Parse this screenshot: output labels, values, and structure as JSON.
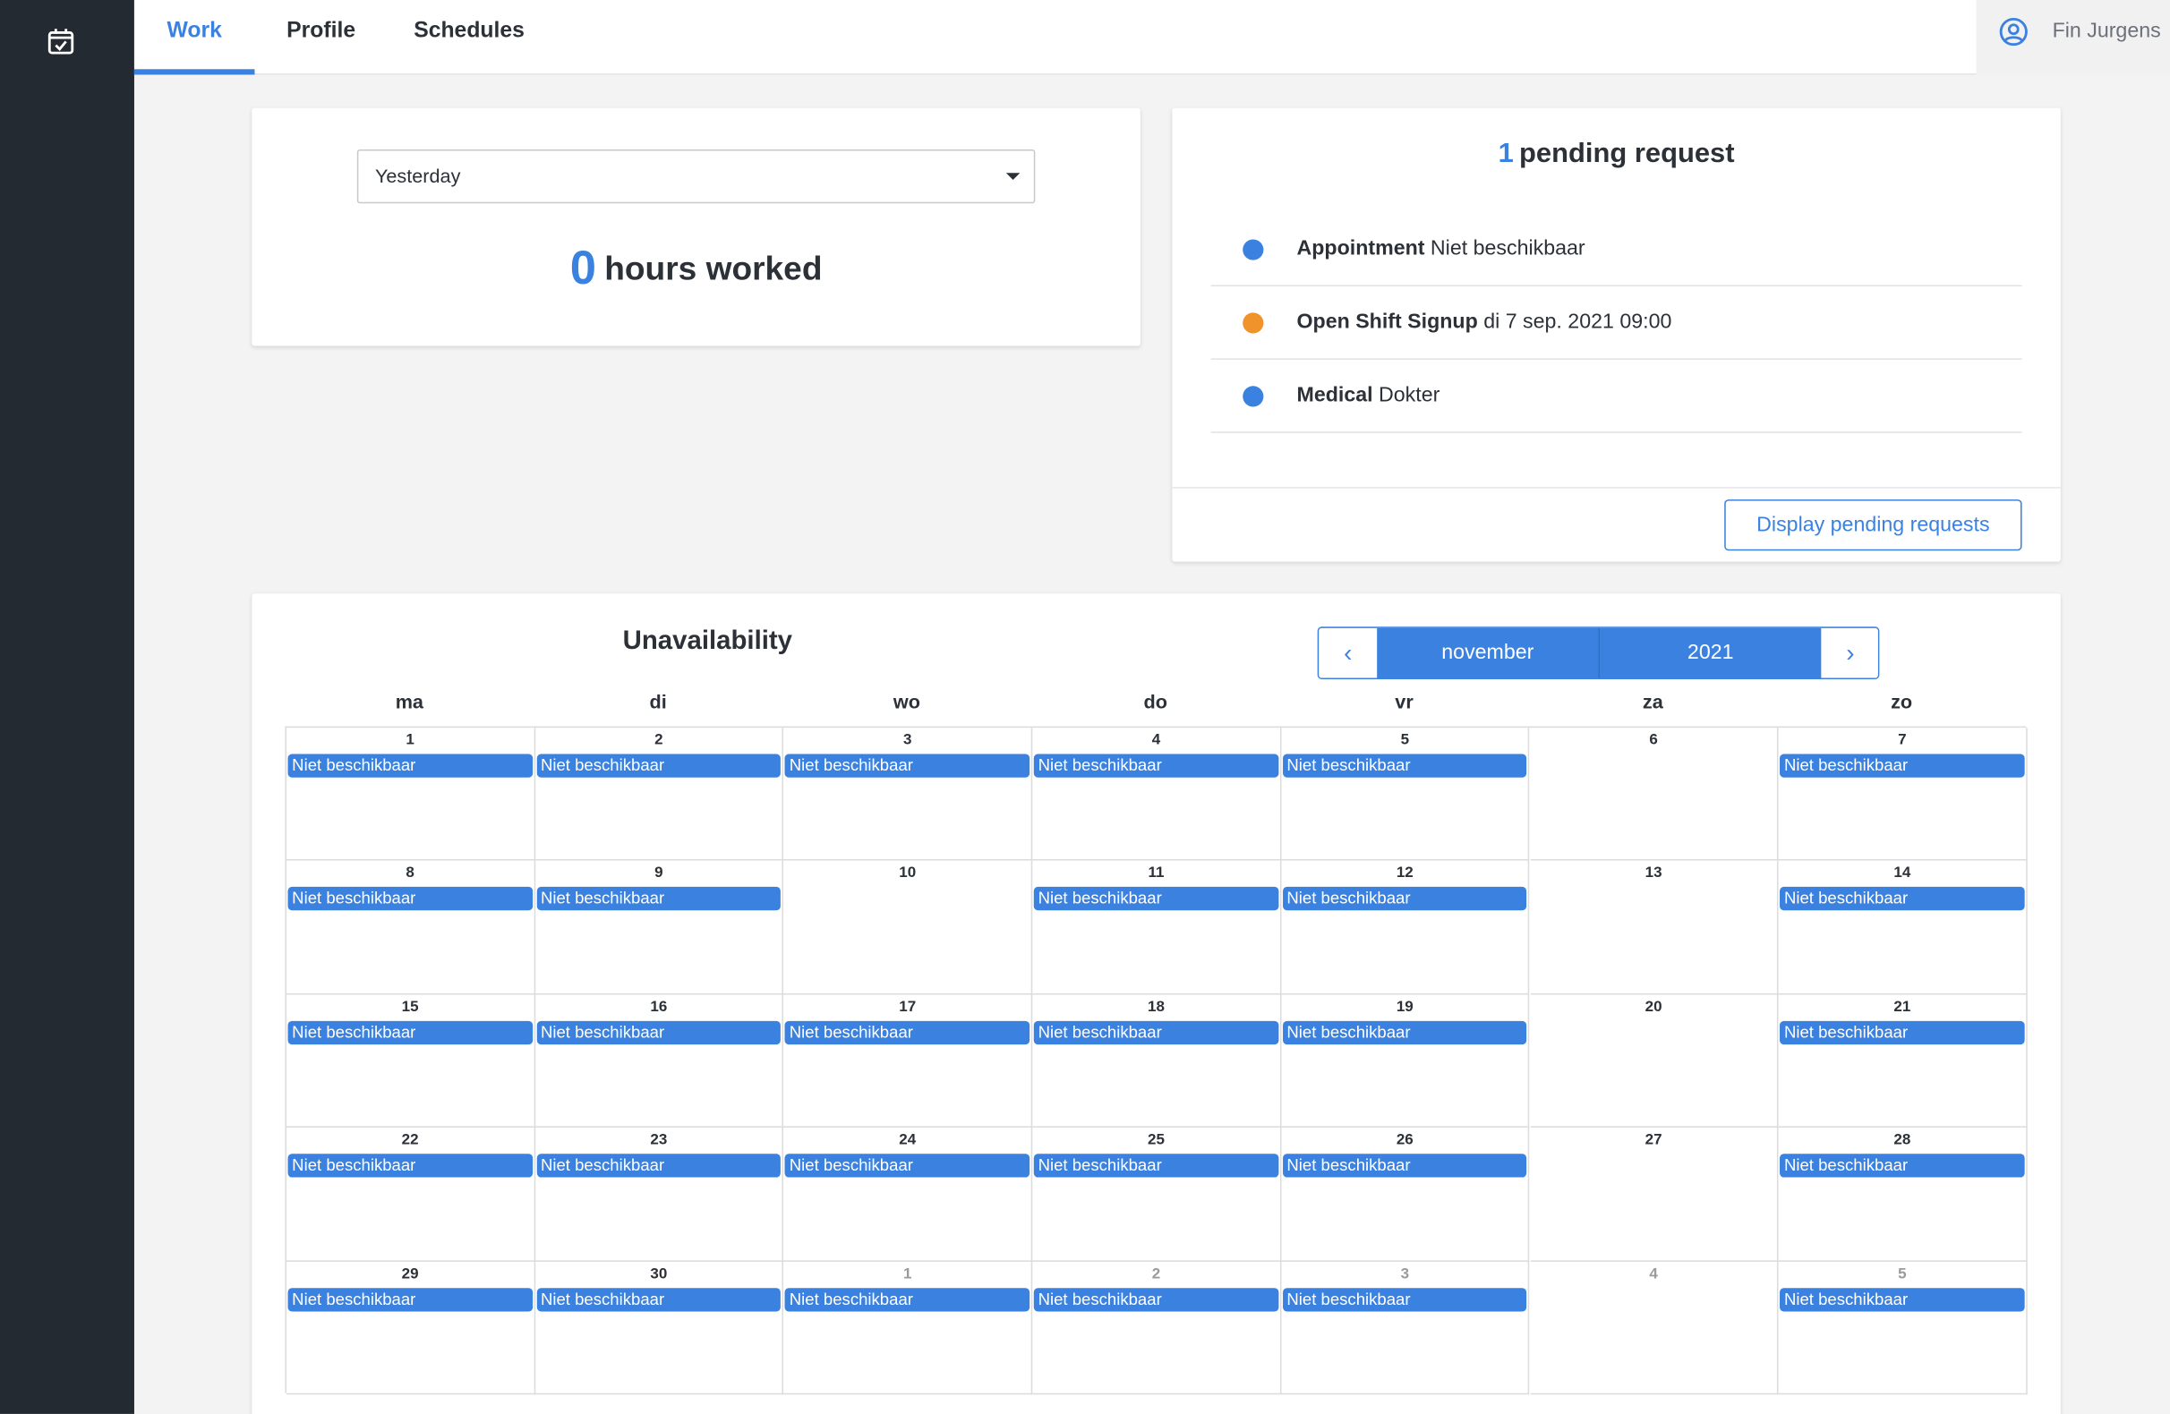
{
  "app": {
    "brand_icon": "calendar-check-icon",
    "accent": "#3b82e0",
    "warning": "#f0932b",
    "sidebar_bg": "#242a31"
  },
  "nav": {
    "tabs": [
      {
        "label": "Work",
        "active": true
      },
      {
        "label": "Profile",
        "active": false
      },
      {
        "label": "Schedules",
        "active": false
      }
    ],
    "user": {
      "name": "Fin Jurgens",
      "icon": "user-circle-icon"
    }
  },
  "hours_card": {
    "period_select": "Yesterday",
    "hours_value": "0",
    "hours_label": "hours worked"
  },
  "pending": {
    "count": "1",
    "title": "pending request",
    "requests": [
      {
        "type": "Appointment",
        "detail": "Niet beschikbaar",
        "color": "#3b82e0"
      },
      {
        "type": "Open Shift Signup",
        "detail": "di 7 sep. 2021 09:00",
        "color": "#f0932b"
      },
      {
        "type": "Medical",
        "detail": "Dokter",
        "color": "#3b82e0"
      }
    ],
    "button_label": "Display pending requests"
  },
  "calendar": {
    "title": "Unavailability",
    "month": "november",
    "year": "2021",
    "prev_icon": "chevron-left-icon",
    "next_icon": "chevron-right-icon",
    "weekdays": [
      "ma",
      "di",
      "wo",
      "do",
      "vr",
      "za",
      "zo"
    ],
    "event_label": "Niet beschikbaar",
    "weeks": [
      [
        {
          "d": "1",
          "ev": true
        },
        {
          "d": "2",
          "ev": true
        },
        {
          "d": "3",
          "ev": true
        },
        {
          "d": "4",
          "ev": true
        },
        {
          "d": "5",
          "ev": true
        },
        {
          "d": "6",
          "ev": false
        },
        {
          "d": "7",
          "ev": true
        }
      ],
      [
        {
          "d": "8",
          "ev": true
        },
        {
          "d": "9",
          "ev": true
        },
        {
          "d": "10",
          "ev": false
        },
        {
          "d": "11",
          "ev": true
        },
        {
          "d": "12",
          "ev": true
        },
        {
          "d": "13",
          "ev": false
        },
        {
          "d": "14",
          "ev": true
        }
      ],
      [
        {
          "d": "15",
          "ev": true
        },
        {
          "d": "16",
          "ev": true
        },
        {
          "d": "17",
          "ev": true
        },
        {
          "d": "18",
          "ev": true
        },
        {
          "d": "19",
          "ev": true
        },
        {
          "d": "20",
          "ev": false
        },
        {
          "d": "21",
          "ev": true
        }
      ],
      [
        {
          "d": "22",
          "ev": true
        },
        {
          "d": "23",
          "ev": true
        },
        {
          "d": "24",
          "ev": true
        },
        {
          "d": "25",
          "ev": true
        },
        {
          "d": "26",
          "ev": true
        },
        {
          "d": "27",
          "ev": false
        },
        {
          "d": "28",
          "ev": true
        }
      ],
      [
        {
          "d": "29",
          "ev": true
        },
        {
          "d": "30",
          "ev": true
        },
        {
          "d": "1",
          "ev": true,
          "other": true
        },
        {
          "d": "2",
          "ev": true,
          "other": true
        },
        {
          "d": "3",
          "ev": true,
          "other": true
        },
        {
          "d": "4",
          "ev": false,
          "other": true
        },
        {
          "d": "5",
          "ev": true,
          "other": true
        }
      ]
    ]
  }
}
